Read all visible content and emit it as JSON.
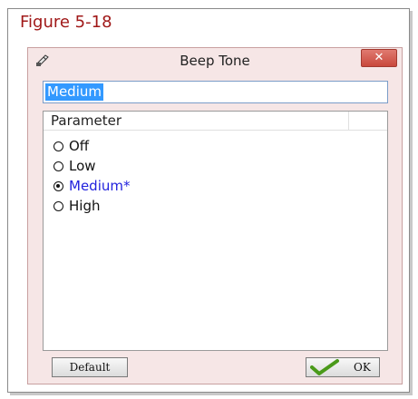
{
  "figure_caption": "Figure 5-18",
  "dialog": {
    "title": "Beep Tone",
    "close_label": "✕",
    "value_field": "Medium",
    "list_header": "Parameter",
    "options": [
      {
        "label": "Off",
        "selected": false
      },
      {
        "label": "Low",
        "selected": false
      },
      {
        "label": "Medium*",
        "selected": true
      },
      {
        "label": "High",
        "selected": false
      }
    ],
    "default_button": "Default",
    "ok_button": "OK"
  },
  "colors": {
    "caption": "#a01818",
    "selected_option": "#2222dd",
    "selection_highlight": "#3399ff",
    "close_button": "#c9483c",
    "check": "#4a9a1a"
  },
  "icons": [
    "app-icon",
    "close-icon",
    "radio-icon",
    "check-icon"
  ]
}
